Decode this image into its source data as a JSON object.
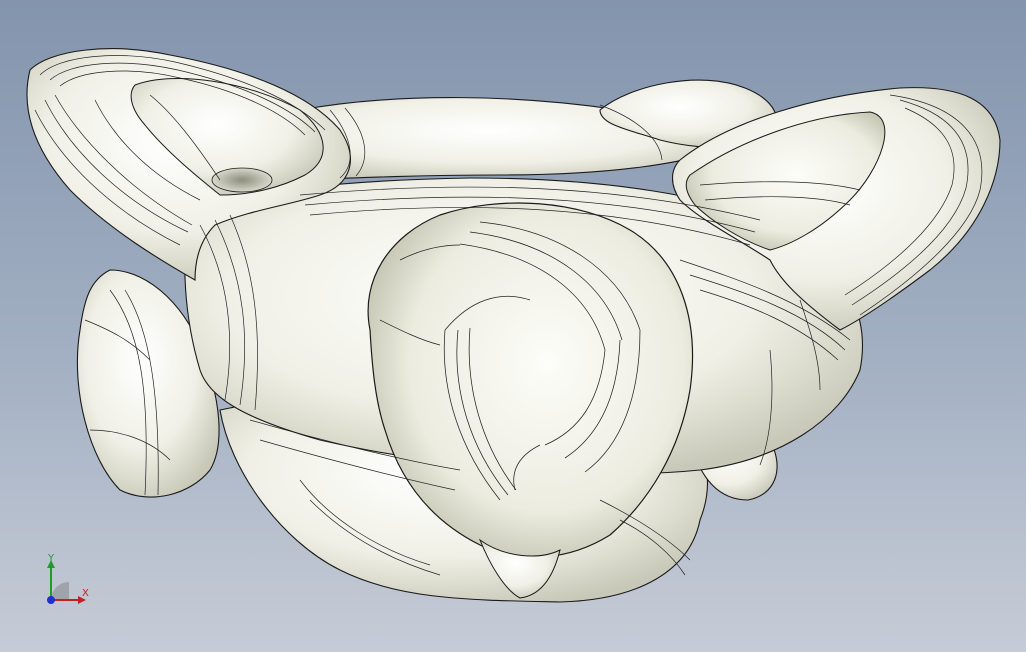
{
  "viewport": {
    "background_top": "#8394ad",
    "background_bottom": "#c6ccd6",
    "model_fill": "#eeeee2",
    "model_edge": "#111111"
  },
  "triad": {
    "x_label": "X",
    "y_label": "Y",
    "x_color": "#c42020",
    "y_color": "#1f9a2b",
    "z_color": "#1f2fd0"
  }
}
